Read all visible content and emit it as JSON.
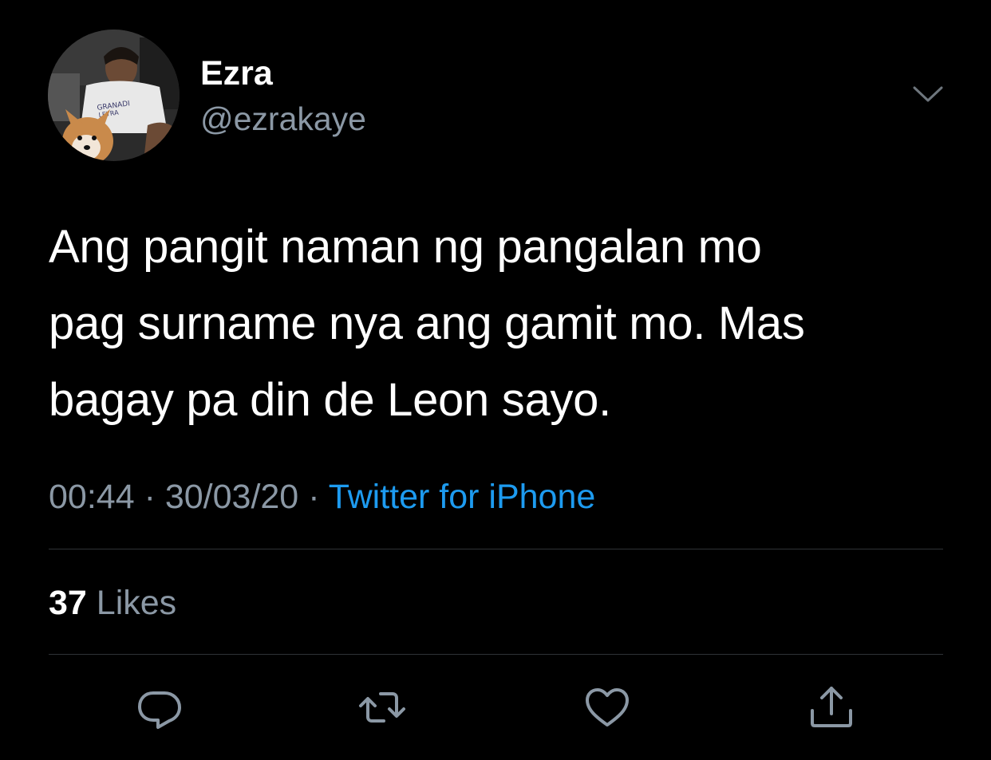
{
  "author": {
    "display_name": "Ezra",
    "handle": "@ezrakaye",
    "avatar_shirt_text": [
      "GRANADI",
      "LEYRA"
    ]
  },
  "tweet": {
    "text_lines": [
      "Ang pangit naman ng pangalan mo",
      "pag surname nya ang gamit mo. Mas",
      "bagay pa din de Leon sayo."
    ],
    "time": "00:44",
    "separator": "·",
    "date": "30/03/20",
    "source": "Twitter for iPhone"
  },
  "stats": {
    "likes_count": "37",
    "likes_label": "Likes"
  },
  "actions": [
    "reply-icon",
    "retweet-icon",
    "like-icon",
    "share-icon"
  ],
  "colors": {
    "background": "#000000",
    "primary_text": "#ffffff",
    "secondary_text": "#8b98a5",
    "link": "#1d9bf0",
    "divider": "#2f3336"
  }
}
